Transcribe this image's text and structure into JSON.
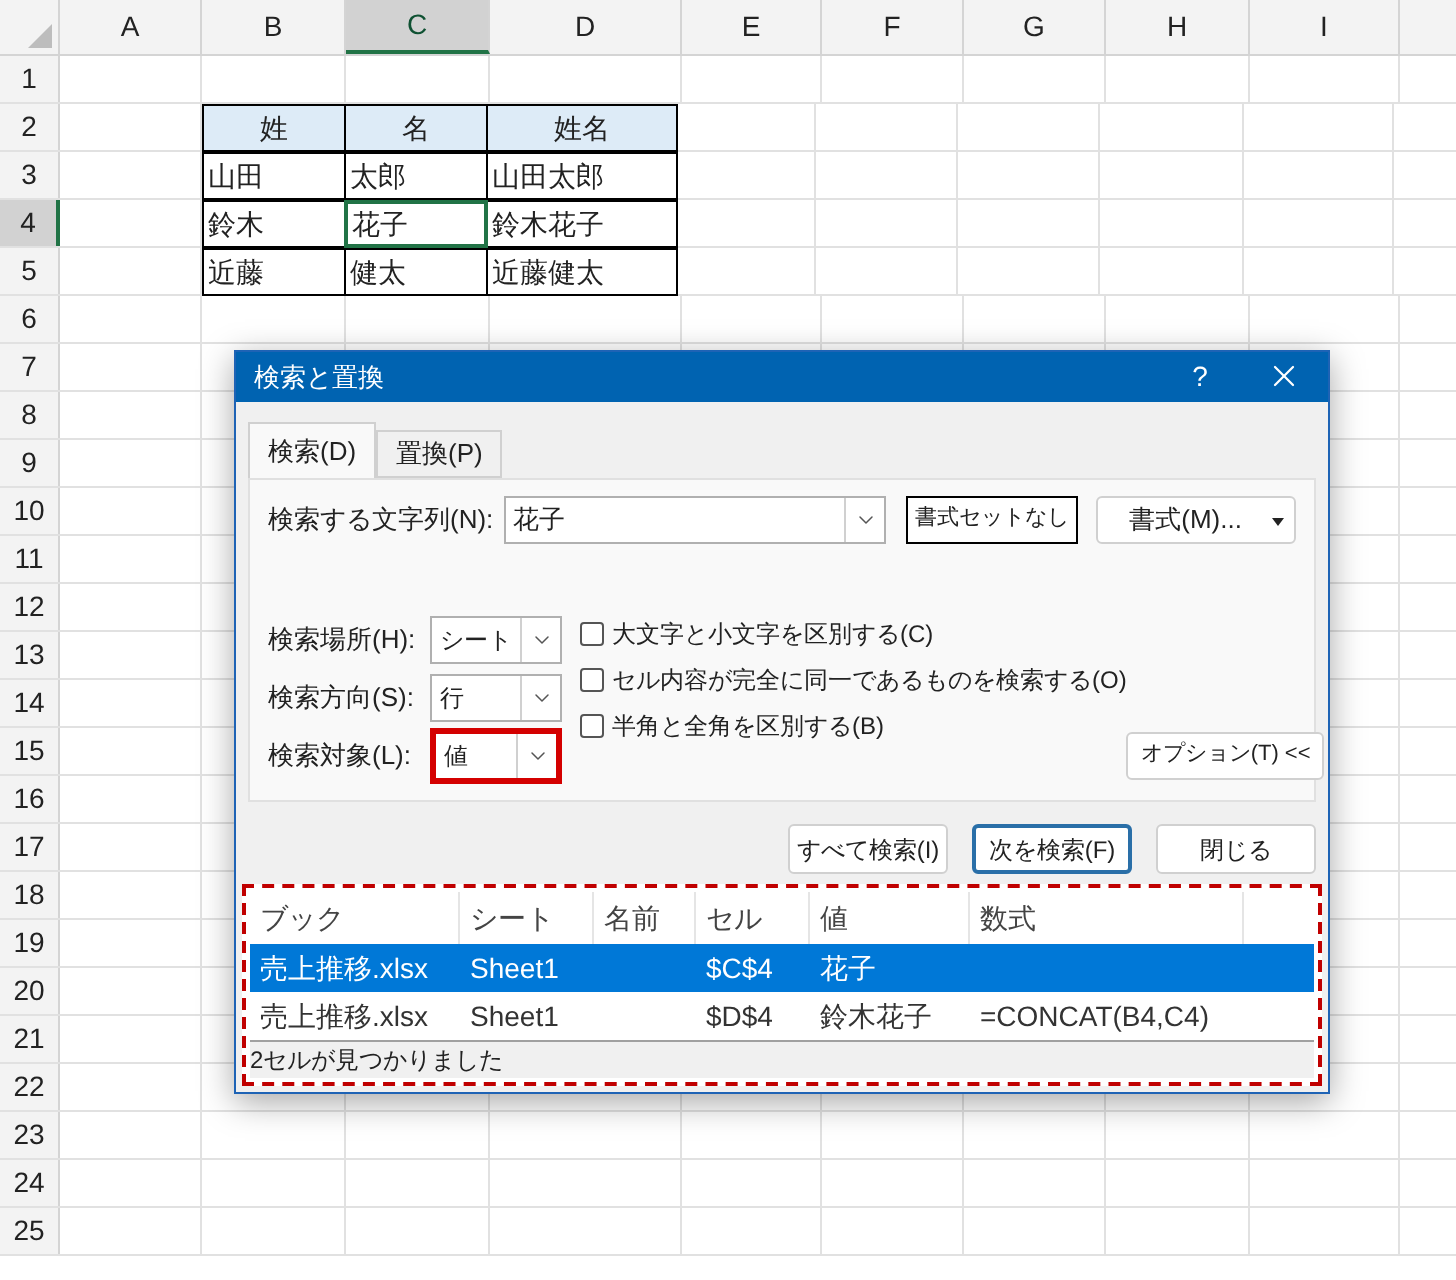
{
  "sheet": {
    "columns": [
      {
        "label": "A",
        "selected": false
      },
      {
        "label": "B",
        "selected": false
      },
      {
        "label": "C",
        "selected": true
      },
      {
        "label": "D",
        "selected": false
      },
      {
        "label": "E",
        "selected": false
      },
      {
        "label": "F",
        "selected": false
      },
      {
        "label": "G",
        "selected": false
      },
      {
        "label": "H",
        "selected": false
      },
      {
        "label": "I",
        "selected": false
      }
    ],
    "rows": [
      {
        "label": "1",
        "selected": false
      },
      {
        "label": "2",
        "selected": false
      },
      {
        "label": "3",
        "selected": false
      },
      {
        "label": "4",
        "selected": true
      },
      {
        "label": "5",
        "selected": false
      },
      {
        "label": "6",
        "selected": false
      },
      {
        "label": "7",
        "selected": false
      },
      {
        "label": "8",
        "selected": false
      },
      {
        "label": "9",
        "selected": false
      },
      {
        "label": "10",
        "selected": false
      },
      {
        "label": "11",
        "selected": false
      },
      {
        "label": "12",
        "selected": false
      },
      {
        "label": "13",
        "selected": false
      },
      {
        "label": "14",
        "selected": false
      },
      {
        "label": "15",
        "selected": false
      },
      {
        "label": "16",
        "selected": false
      },
      {
        "label": "17",
        "selected": false
      },
      {
        "label": "18",
        "selected": false
      },
      {
        "label": "19",
        "selected": false
      },
      {
        "label": "20",
        "selected": false
      },
      {
        "label": "21",
        "selected": false
      },
      {
        "label": "22",
        "selected": false
      },
      {
        "label": "23",
        "selected": false
      },
      {
        "label": "24",
        "selected": false
      },
      {
        "label": "25",
        "selected": false
      }
    ],
    "table": {
      "header": [
        "姓",
        "名",
        "姓名"
      ],
      "rows": [
        [
          {
            "text": "山田",
            "selected": false
          },
          {
            "text": "太郎",
            "selected": false
          },
          {
            "text": "山田太郎",
            "selected": false
          }
        ],
        [
          {
            "text": "鈴木",
            "selected": false
          },
          {
            "text": "花子",
            "selected": true
          },
          {
            "text": "鈴木花子",
            "selected": false
          }
        ],
        [
          {
            "text": "近藤",
            "selected": false
          },
          {
            "text": "健太",
            "selected": false
          },
          {
            "text": "近藤健太",
            "selected": false
          }
        ]
      ]
    }
  },
  "dialog": {
    "title": "検索と置換",
    "help": "?",
    "tabs": [
      {
        "label": "検索(D)",
        "selected": true
      },
      {
        "label": "置換(P)",
        "selected": false
      }
    ],
    "find_what": {
      "label": "検索する文字列(N):",
      "value": "花子"
    },
    "format_preview": "書式セットなし",
    "format_button": "書式(M)...",
    "dropdowns": [
      {
        "label": "検索場所(H):",
        "value": "シート",
        "highlighted": false
      },
      {
        "label": "検索方向(S):",
        "value": "行",
        "highlighted": false
      },
      {
        "label": "検索対象(L):",
        "value": "値",
        "highlighted": true
      }
    ],
    "checkboxes": [
      {
        "label": "大文字と小文字を区別する(C)",
        "checked": false
      },
      {
        "label": "セル内容が完全に同一であるものを検索する(O)",
        "checked": false
      },
      {
        "label": "半角と全角を区別する(B)",
        "checked": false
      }
    ],
    "options_button": "オプション(T) <<",
    "buttons": [
      {
        "label": "すべて検索(I)",
        "default": false
      },
      {
        "label": "次を検索(F)",
        "default": true
      },
      {
        "label": "閉じる",
        "default": false
      }
    ],
    "results": {
      "highlighted": true,
      "columns": [
        "ブック",
        "シート",
        "名前",
        "セル",
        "値",
        "数式"
      ],
      "rows": [
        {
          "selected": true,
          "cells": [
            "売上推移.xlsx",
            "Sheet1",
            "",
            "$C$4",
            "花子",
            ""
          ]
        },
        {
          "selected": false,
          "cells": [
            "売上推移.xlsx",
            "Sheet1",
            "",
            "$D$4",
            "鈴木花子",
            "=CONCAT(B4,C4)"
          ]
        }
      ],
      "status": "2セルが見つかりました"
    }
  }
}
